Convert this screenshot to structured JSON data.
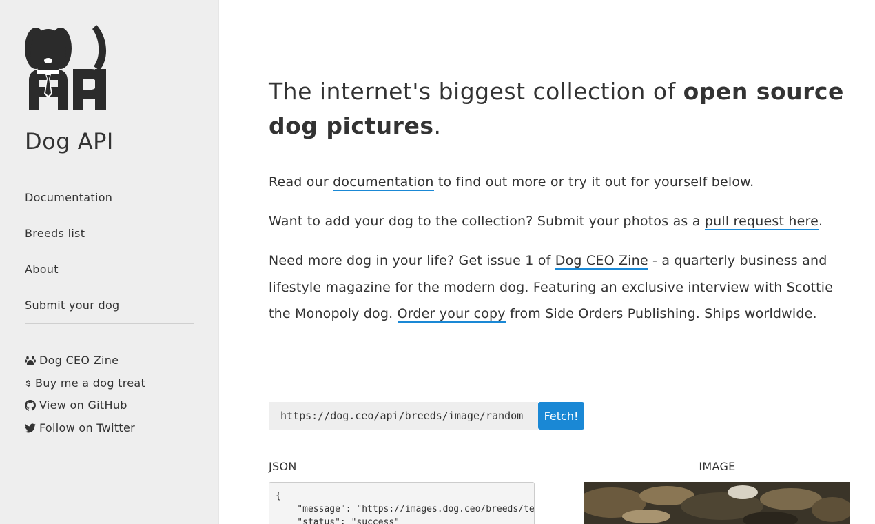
{
  "sidebar": {
    "site_title": "Dog API",
    "nav": [
      {
        "label": "Documentation"
      },
      {
        "label": "Breeds list"
      },
      {
        "label": "About"
      },
      {
        "label": "Submit your dog"
      }
    ],
    "social": [
      {
        "icon": "paw-icon",
        "label": "Dog CEO Zine"
      },
      {
        "icon": "dollar-icon",
        "label": "Buy me a dog treat"
      },
      {
        "icon": "github-icon",
        "label": "View on GitHub"
      },
      {
        "icon": "twitter-icon",
        "label": "Follow on Twitter"
      }
    ]
  },
  "main": {
    "headline": {
      "prefix": "The internet's biggest collection of ",
      "bold": "open source dog pictures",
      "suffix": "."
    },
    "para1": {
      "before": "Read our ",
      "link": "documentation",
      "after": " to find out more or try it out for yourself below."
    },
    "para2": {
      "before": "Want to add your dog to the collection? Submit your photos as a ",
      "link": "pull request here",
      "after": "."
    },
    "para3": {
      "before": "Need more dog in your life? Get issue 1 of ",
      "link1": "Dog CEO Zine",
      "middle": " - a quarterly business and lifestyle magazine for the modern dog. Featuring an exclusive interview with Scottie the Monopoly dog. ",
      "link2": "Order your copy",
      "after": " from Side Orders Publishing. Ships worldwide."
    },
    "fetch": {
      "endpoint_value": "https://dog.ceo/api/breeds/image/random",
      "button_label": "Fetch!"
    },
    "json_label": "JSON",
    "image_label": "IMAGE",
    "json_text": "{\n    \"message\": \"https://images.dog.ceo/breeds/te\n    \"status\": \"success\""
  },
  "colors": {
    "accent": "#1a88d5",
    "sidebar_bg": "#eeeeee",
    "text": "#333333"
  }
}
